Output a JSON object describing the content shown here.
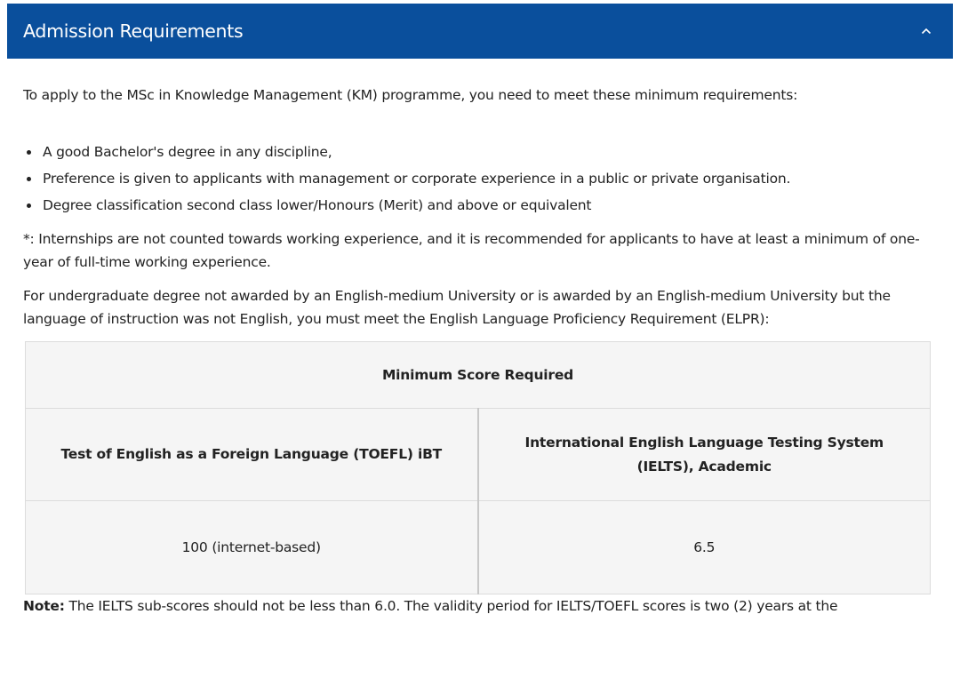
{
  "panel": {
    "title": "Admission Requirements",
    "toggle_icon": "chevron-up-icon",
    "header_color": "#0a4f9c"
  },
  "content": {
    "intro": "To apply to the MSc in Knowledge Management (KM) programme, you need to meet these minimum requirements:",
    "requirements": [
      "A good Bachelor's degree in any discipline,",
      "Preference is given to applicants with management or corporate experience in a public or private organisation.",
      "Degree classification second class lower/Honours (Merit) and above or equivalent"
    ],
    "internship_note": "*: Internships are not counted towards working experience, and it is recommended for applicants to have at least a minimum of one-year of full-time working experience.",
    "elpr_intro": "For undergraduate degree not awarded by an English-medium University or is awarded by an English-medium University but the language of instruction was not English, you must meet the English Language Proficiency Requirement (ELPR):",
    "table": {
      "header": "Minimum Score Required",
      "columns": [
        "Test of English as a Foreign Language (TOEFL) iBT",
        "International English Language Testing System (IELTS), Academic"
      ],
      "values": [
        "100 (internet-based)",
        "6.5"
      ]
    },
    "note_label": "Note:",
    "note_text": " The IELTS sub-scores should not be less than 6.0. The validity period for IELTS/TOEFL scores is two (2) years at the"
  }
}
